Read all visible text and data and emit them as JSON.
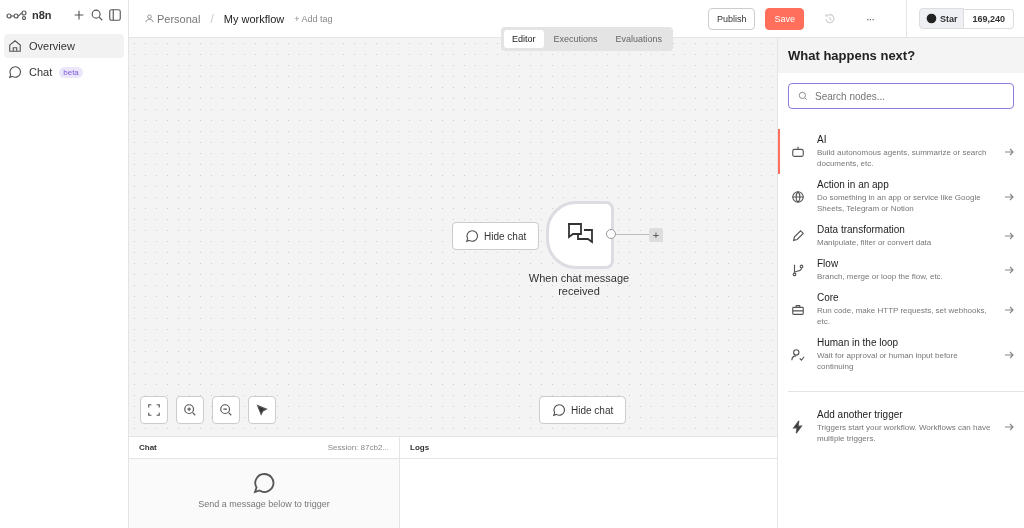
{
  "sidebar": {
    "brand": "n8n",
    "items": [
      {
        "label": "Overview",
        "selected": true
      },
      {
        "label": "Chat",
        "selected": false,
        "badge": "beta"
      }
    ]
  },
  "header": {
    "breadcrumb": "Personal",
    "separator": "/",
    "workflow_name": "My workflow",
    "add_tag": "+ Add tag",
    "publish": "Publish",
    "save": "Save",
    "more": "···",
    "star": "Star",
    "star_count": "169,240"
  },
  "view_tabs": [
    {
      "label": "Editor",
      "selected": true
    },
    {
      "label": "Executions",
      "selected": false
    },
    {
      "label": "Evaluations",
      "selected": false
    }
  ],
  "canvas": {
    "node": {
      "label": "When chat message received",
      "plus": "+"
    },
    "hide_chat_node": "Hide chat",
    "hide_chat_button": "Hide chat"
  },
  "chat_panel": {
    "title": "Chat",
    "session": "Session: 87cb2...",
    "empty_text": "Send a message below to trigger"
  },
  "logs_panel": {
    "title": "Logs"
  },
  "next_panel": {
    "title": "What happens next?",
    "search": {
      "placeholder": "Search nodes..."
    },
    "items": [
      {
        "title": "AI",
        "desc": "Build autonomous agents, summarize or search documents, etc.",
        "selected": true
      },
      {
        "title": "Action in an app",
        "desc": "Do something in an app or service like Google Sheets, Telegram or Notion",
        "selected": false
      },
      {
        "title": "Data transformation",
        "desc": "Manipulate, filter or convert data",
        "selected": false
      },
      {
        "title": "Flow",
        "desc": "Branch, merge or loop the flow, etc.",
        "selected": false
      },
      {
        "title": "Core",
        "desc": "Run code, make HTTP requests, set webhooks, etc.",
        "selected": false
      },
      {
        "title": "Human in the loop",
        "desc": "Wait for approval or human input before continuing",
        "selected": false
      }
    ],
    "trigger": {
      "title": "Add another trigger",
      "desc": "Triggers start your workflow. Workflows can have multiple triggers.",
      "selected": false
    }
  }
}
